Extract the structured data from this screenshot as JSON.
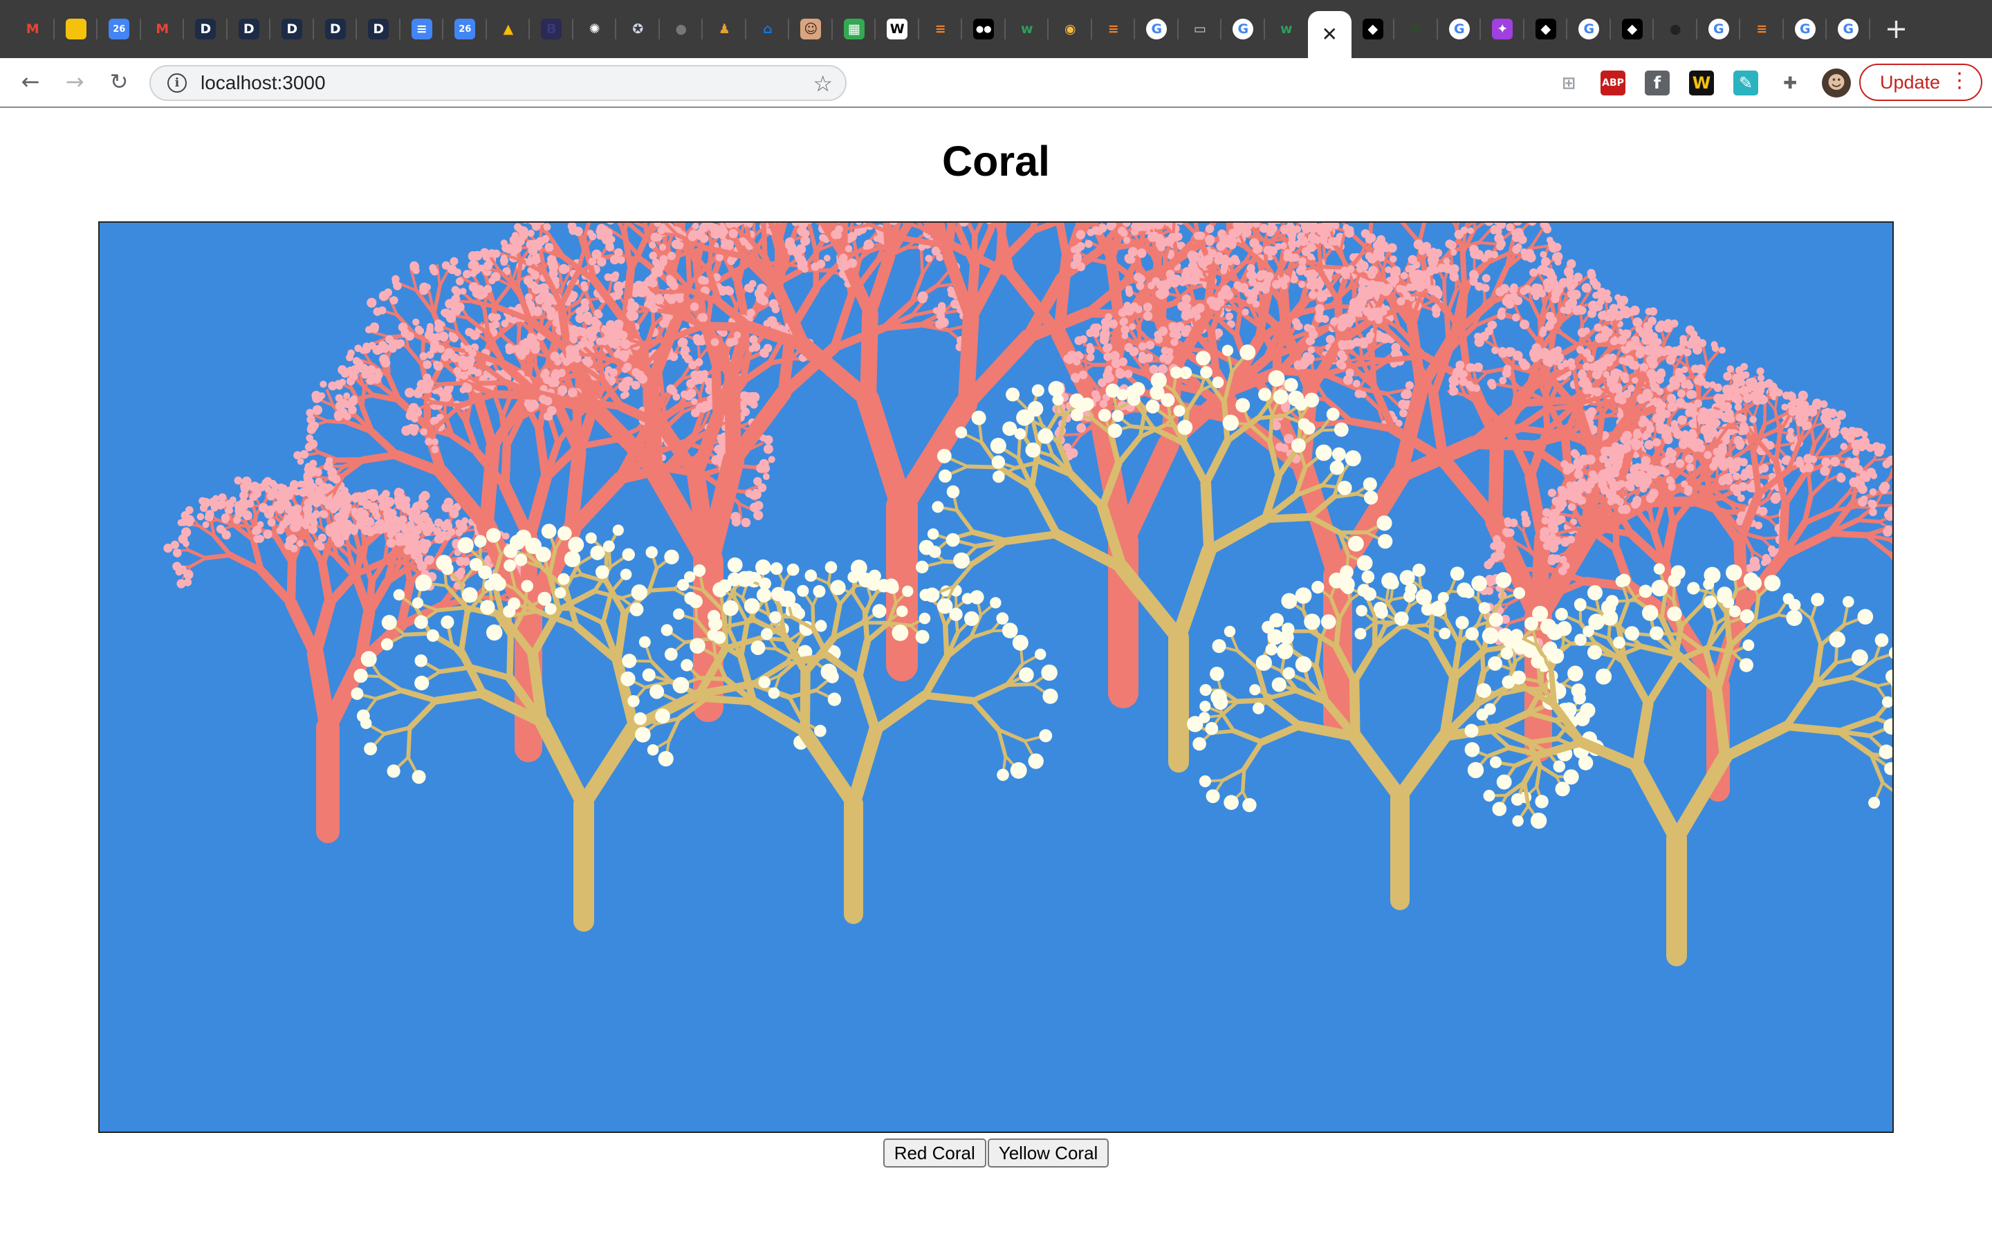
{
  "browser": {
    "tabs": [
      {
        "icon": "gmail-icon",
        "glyph": "M",
        "bg": "#3c3c3c",
        "fg": "#ea4335"
      },
      {
        "icon": "keep-icon",
        "glyph": "",
        "bg": "#f4c20d",
        "fg": "#ffffff"
      },
      {
        "icon": "calendar-icon",
        "glyph": "26",
        "bg": "#4285f4",
        "fg": "#ffffff"
      },
      {
        "icon": "gmail-icon",
        "glyph": "M",
        "bg": "#3c3c3c",
        "fg": "#ea4335"
      },
      {
        "icon": "d-app-icon",
        "glyph": "D",
        "bg": "#1d2b47",
        "fg": "#ffffff"
      },
      {
        "icon": "d-app-icon",
        "glyph": "D",
        "bg": "#1d2b47",
        "fg": "#ffffff"
      },
      {
        "icon": "d-app-icon",
        "glyph": "D",
        "bg": "#1d2b47",
        "fg": "#ffffff"
      },
      {
        "icon": "d-app-icon",
        "glyph": "D",
        "bg": "#1d2b47",
        "fg": "#ffffff"
      },
      {
        "icon": "d-app-icon",
        "glyph": "D",
        "bg": "#1d2b47",
        "fg": "#ffffff"
      },
      {
        "icon": "docs-icon",
        "glyph": "≡",
        "bg": "#4285f4",
        "fg": "#ffffff"
      },
      {
        "icon": "calendar-icon",
        "glyph": "26",
        "bg": "#4285f4",
        "fg": "#ffffff"
      },
      {
        "icon": "drive-icon",
        "glyph": "▲",
        "bg": "#3c3c3c",
        "fg": "#fbbc04"
      },
      {
        "icon": "bootstrap-icon",
        "glyph": "B",
        "bg": "#2a2a55",
        "fg": "#3a3a7a"
      },
      {
        "icon": "wheel-icon",
        "glyph": "✺",
        "bg": "#3c3c3c",
        "fg": "#ffffff"
      },
      {
        "icon": "seal-icon",
        "glyph": "✪",
        "bg": "#3c3c3c",
        "fg": "#cfd8e8"
      },
      {
        "icon": "circle-icon",
        "glyph": "●",
        "bg": "#3c3c3c",
        "fg": "#777777"
      },
      {
        "icon": "figure-icon",
        "glyph": "♟",
        "bg": "#3c3c3c",
        "fg": "#e8a030"
      },
      {
        "icon": "zillow-icon",
        "glyph": "⌂",
        "bg": "#3c3c3c",
        "fg": "#1277e1"
      },
      {
        "icon": "avatar-icon",
        "glyph": "☺",
        "bg": "#d9a47f",
        "fg": "#3a2a20"
      },
      {
        "icon": "calculator-icon",
        "glyph": "▦",
        "bg": "#34a853",
        "fg": "#ffffff"
      },
      {
        "icon": "wikipedia-icon",
        "glyph": "W",
        "bg": "#ffffff",
        "fg": "#000000"
      },
      {
        "icon": "stackoverflow-icon",
        "glyph": "≡",
        "bg": "#3c3c3c",
        "fg": "#f48024"
      },
      {
        "icon": "medium-icon",
        "glyph": "●●",
        "bg": "#000000",
        "fg": "#ffffff"
      },
      {
        "icon": "w-icon",
        "glyph": "w",
        "bg": "#3c3c3c",
        "fg": "#2e9e5e"
      },
      {
        "icon": "citrus-icon",
        "glyph": "◉",
        "bg": "#3c3c3c",
        "fg": "#f5b942"
      },
      {
        "icon": "stackoverflow-icon",
        "glyph": "≡",
        "bg": "#3c3c3c",
        "fg": "#f48024"
      },
      {
        "icon": "google-icon",
        "glyph": "G",
        "bg": "#ffffff",
        "fg": "#4285f4"
      },
      {
        "icon": "window-icon",
        "glyph": "▭",
        "bg": "#3c3c3c",
        "fg": "#cccccc"
      },
      {
        "icon": "google-icon",
        "glyph": "G",
        "bg": "#ffffff",
        "fg": "#4285f4"
      },
      {
        "icon": "w-icon",
        "glyph": "w",
        "bg": "#3c3c3c",
        "fg": "#2e9e5e"
      },
      {
        "icon": "close-icon",
        "glyph": "✕",
        "bg": "#ffffff",
        "fg": "#222222",
        "active": true
      },
      {
        "icon": "codepen-icon",
        "glyph": "◆",
        "bg": "#000000",
        "fg": "#ffffff"
      },
      {
        "icon": "leaf-icon",
        "glyph": "♣",
        "bg": "#3c3c3c",
        "fg": "#2e4a2e"
      },
      {
        "icon": "google-icon",
        "glyph": "G",
        "bg": "#ffffff",
        "fg": "#4285f4"
      },
      {
        "icon": "messenger-icon",
        "glyph": "✦",
        "bg": "#a040e0",
        "fg": "#ffffff"
      },
      {
        "icon": "codepen-icon",
        "glyph": "◆",
        "bg": "#000000",
        "fg": "#ffffff"
      },
      {
        "icon": "google-icon",
        "glyph": "G",
        "bg": "#ffffff",
        "fg": "#4285f4"
      },
      {
        "icon": "codepen-icon",
        "glyph": "◆",
        "bg": "#000000",
        "fg": "#ffffff"
      },
      {
        "icon": "github-icon",
        "glyph": "●",
        "bg": "#3c3c3c",
        "fg": "#222222"
      },
      {
        "icon": "google-icon",
        "glyph": "G",
        "bg": "#ffffff",
        "fg": "#4285f4"
      },
      {
        "icon": "stackoverflow-icon",
        "glyph": "≡",
        "bg": "#3c3c3c",
        "fg": "#f48024"
      },
      {
        "icon": "google-icon",
        "glyph": "G",
        "bg": "#ffffff",
        "fg": "#4285f4"
      },
      {
        "icon": "google-icon",
        "glyph": "G",
        "bg": "#ffffff",
        "fg": "#4285f4"
      }
    ],
    "new_tab_glyph": "+",
    "url": "localhost:3000",
    "extensions": [
      {
        "icon": "pocket-extension-icon",
        "glyph": "⊞",
        "bg": "#ffffff",
        "fg": "#9aa0a6"
      },
      {
        "icon": "adblock-icon",
        "glyph": "ABP",
        "bg": "#c61b1b",
        "fg": "#ffffff"
      },
      {
        "icon": "facebook-icon",
        "glyph": "f",
        "bg": "#5f6368",
        "fg": "#ffffff"
      },
      {
        "icon": "wappalyzer-icon",
        "glyph": "W",
        "bg": "#111111",
        "fg": "#f4c20d"
      },
      {
        "icon": "quill-icon",
        "glyph": "✎",
        "bg": "#2bb3c0",
        "fg": "#ffffff"
      },
      {
        "icon": "puzzle-icon",
        "glyph": "✚",
        "bg": "#ffffff",
        "fg": "#5f6368"
      },
      {
        "icon": "profile-avatar-icon",
        "glyph": "☻",
        "bg": "#4a3a30",
        "fg": "#e0c0a0"
      }
    ],
    "update_label": "Update"
  },
  "page": {
    "title": "Coral",
    "buttons": {
      "red": "Red Coral",
      "yellow": "Yellow Coral"
    }
  },
  "colors": {
    "ocean": "#3b8ade",
    "red_coral": "#f07b72",
    "red_coral_tip": "#fbb0b8",
    "yellow_coral": "#d9bc6e",
    "yellow_coral_tip": "#fffde8"
  }
}
